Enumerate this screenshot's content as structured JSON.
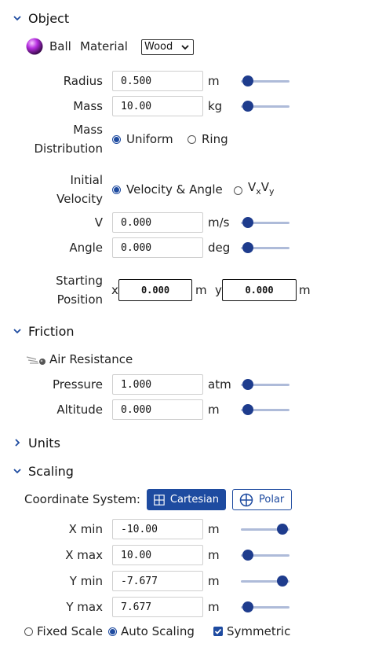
{
  "object": {
    "title": "Object",
    "ball_label": "Ball",
    "material_label": "Material",
    "material_value": "Wood",
    "radius": {
      "label": "Radius",
      "value": "0.500",
      "unit": "m",
      "slider_level": 0.08
    },
    "mass": {
      "label": "Mass",
      "value": "10.00",
      "unit": "kg",
      "slider_level": 0.08
    },
    "mass_distribution": {
      "label_line1": "Mass",
      "label_line2": "Distribution",
      "options": [
        "Uniform",
        "Ring"
      ],
      "selected": "Uniform"
    },
    "initial_velocity": {
      "label_line1": "Initial",
      "label_line2": "Velocity",
      "option_a": "Velocity & Angle",
      "option_b_base1": "V",
      "option_b_sub1": "x",
      "option_b_base2": "V",
      "option_b_sub2": "y",
      "selected": "Velocity & Angle"
    },
    "v": {
      "label": "V",
      "value": "0.000",
      "unit": "m/s",
      "slider_level": 0.08
    },
    "angle": {
      "label": "Angle",
      "value": "0.000",
      "unit": "deg",
      "slider_level": 0.08
    },
    "starting_position": {
      "label_line1": "Starting",
      "label_line2": "Position",
      "x_label": "x",
      "x_value": "0.000",
      "x_unit": "m",
      "y_label": "y",
      "y_value": "0.000",
      "y_unit": "m"
    }
  },
  "friction": {
    "title": "Friction",
    "air_resistance_label": "Air Resistance",
    "pressure": {
      "label": "Pressure",
      "value": "1.000",
      "unit": "atm",
      "slider_level": 0.08
    },
    "altitude": {
      "label": "Altitude",
      "value": "0.000",
      "unit": "m",
      "slider_level": 0.08
    }
  },
  "units": {
    "title": "Units"
  },
  "scaling": {
    "title": "Scaling",
    "coord_label": "Coordinate System:",
    "cartesian_label": "Cartesian",
    "polar_label": "Polar",
    "selected_system": "Cartesian",
    "xmin": {
      "label": "X min",
      "value": "-10.00",
      "unit": "m",
      "slider_level": 0.92
    },
    "xmax": {
      "label": "X max",
      "value": "10.00",
      "unit": "m",
      "slider_level": 0.08
    },
    "ymin": {
      "label": "Y min",
      "value": "-7.677",
      "unit": "m",
      "slider_level": 0.92
    },
    "ymax": {
      "label": "Y max",
      "value": "7.677",
      "unit": "m",
      "slider_level": 0.08
    },
    "fixed_scale_label": "Fixed Scale",
    "auto_scaling_label": "Auto Scaling",
    "scale_mode": "Auto Scaling",
    "symmetric_label": "Symmetric",
    "symmetric_checked": true
  },
  "colors": {
    "accent": "#1e4ba0",
    "slider_track": "#aebbd9",
    "slider_knob": "#1e3c8d"
  }
}
